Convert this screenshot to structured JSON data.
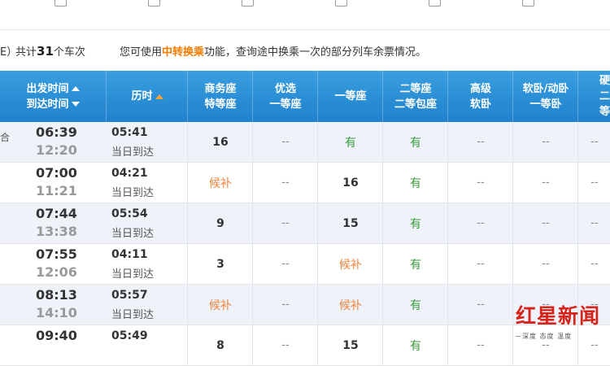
{
  "summary": {
    "cut_prefix": "E）",
    "total_prefix": "共计",
    "total_count": "31",
    "total_suffix": "个车次",
    "tip_prefix": "您可使用",
    "tip_link": "中转换乘",
    "tip_suffix": "功能，查询途中换乘一次的部分列车余票情况。"
  },
  "header": {
    "depart": "出发时间",
    "arrive": "到达时间",
    "duration": "历时",
    "col_business_1": "商务座",
    "col_business_2": "特等座",
    "col_premium_1": "优选",
    "col_premium_2": "一等座",
    "col_first": "一等座",
    "col_second_1": "二等座",
    "col_second_2": "二等包座",
    "col_softsleeper_1": "高级",
    "col_softsleeper_2": "软卧",
    "col_sleeper_1": "软卧/动卧",
    "col_sleeper_2": "一等卧",
    "col_hard_1": "硬",
    "col_hard_2": "二等"
  },
  "rows": [
    {
      "edge": "合",
      "depart": "06:39",
      "arrive": "12:20",
      "duration": "05:41",
      "note": "当日到达",
      "business": "16",
      "premium": "--",
      "first": "有",
      "second": "有",
      "hs": "--",
      "sleeper": "--",
      "hard": "--"
    },
    {
      "edge": "",
      "depart": "07:00",
      "arrive": "11:21",
      "duration": "04:21",
      "note": "当日到达",
      "business": "候补",
      "premium": "--",
      "first": "16",
      "second": "有",
      "hs": "--",
      "sleeper": "--",
      "hard": "--"
    },
    {
      "edge": "",
      "depart": "07:44",
      "arrive": "13:38",
      "duration": "05:54",
      "note": "当日到达",
      "business": "9",
      "premium": "--",
      "first": "15",
      "second": "有",
      "hs": "--",
      "sleeper": "--",
      "hard": "--"
    },
    {
      "edge": "",
      "depart": "07:55",
      "arrive": "12:06",
      "duration": "04:11",
      "note": "当日到达",
      "business": "3",
      "premium": "--",
      "first": "候补",
      "second": "有",
      "hs": "--",
      "sleeper": "--",
      "hard": "--"
    },
    {
      "edge": "",
      "depart": "08:13",
      "arrive": "14:10",
      "duration": "05:57",
      "note": "当日到达",
      "business": "候补",
      "premium": "--",
      "first": "候补",
      "second": "有",
      "hs": "--",
      "sleeper": "--",
      "hard": "--"
    },
    {
      "edge": "",
      "depart": "09:40",
      "arrive": "",
      "duration": "05:49",
      "note": "",
      "business": "8",
      "premium": "--",
      "first": "15",
      "second": "有",
      "hs": "--",
      "sleeper": "--",
      "hard": "--"
    }
  ],
  "watermark": {
    "logo": "红星新闻",
    "tagline": "深度 态度 温度"
  },
  "colors": {
    "header_blue": "#2a8fd6",
    "link_orange": "#f77b00",
    "available_green": "#3a9a3a",
    "waitlist_orange": "#f0843c",
    "row_tint": "#eef3fa"
  }
}
